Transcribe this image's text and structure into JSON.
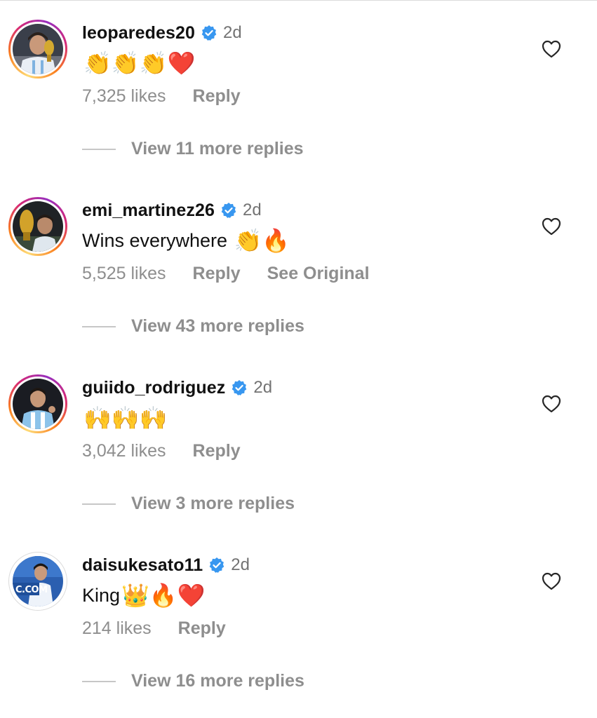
{
  "comments": [
    {
      "username": "leoparedes20",
      "verified": true,
      "time": "2d",
      "text": "",
      "emoji": "👏👏👏❤️",
      "likes": "7,325 likes",
      "reply": "Reply",
      "see_original": "",
      "view_replies": "View 11 more replies",
      "story_ring": true
    },
    {
      "username": "emi_martinez26",
      "verified": true,
      "time": "2d",
      "text": "Wins everywhere ",
      "emoji": "👏🔥",
      "likes": "5,525 likes",
      "reply": "Reply",
      "see_original": "See Original",
      "view_replies": "View 43 more replies",
      "story_ring": true
    },
    {
      "username": "guiido_rodriguez",
      "verified": true,
      "time": "2d",
      "text": "",
      "emoji": "🙌🙌🙌",
      "likes": "3,042 likes",
      "reply": "Reply",
      "see_original": "",
      "view_replies": "View 3 more replies",
      "story_ring": true
    },
    {
      "username": "daisukesato11",
      "verified": true,
      "time": "2d",
      "text": "King",
      "emoji": "👑🔥❤️",
      "likes": "214 likes",
      "reply": "Reply",
      "see_original": "",
      "view_replies": "View 16 more replies",
      "story_ring": false
    }
  ],
  "avatar_overlay_text": "C.COM",
  "colors": {
    "verified_blue": "#3897f0",
    "secondary_text": "#737373",
    "meta_text": "#8e8e8e",
    "primary_text": "#111111"
  },
  "icons": {
    "like": "heart-outline-icon",
    "verified": "verified-badge-icon"
  }
}
